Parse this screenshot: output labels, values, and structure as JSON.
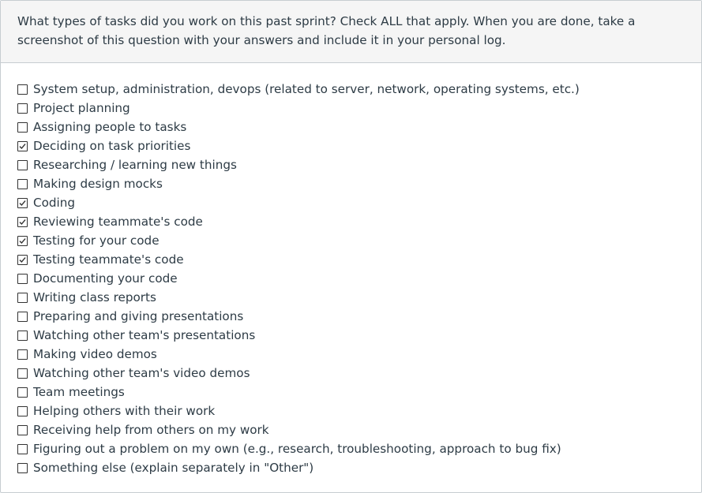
{
  "question": {
    "text": "What types of tasks did you work on this past sprint? Check ALL that apply. When you are done, take a screenshot of this question with your answers and include it in your personal log."
  },
  "options": [
    {
      "label": "System setup, administration, devops (related to server, network, operating systems, etc.)",
      "checked": false
    },
    {
      "label": "Project planning",
      "checked": false
    },
    {
      "label": "Assigning people to tasks",
      "checked": false
    },
    {
      "label": "Deciding on task priorities",
      "checked": true
    },
    {
      "label": "Researching / learning new things",
      "checked": false
    },
    {
      "label": "Making design mocks",
      "checked": false
    },
    {
      "label": "Coding",
      "checked": true
    },
    {
      "label": "Reviewing teammate's code",
      "checked": true
    },
    {
      "label": "Testing for your code",
      "checked": true
    },
    {
      "label": "Testing teammate's code",
      "checked": true
    },
    {
      "label": "Documenting your code",
      "checked": false
    },
    {
      "label": "Writing class reports",
      "checked": false
    },
    {
      "label": "Preparing and giving presentations",
      "checked": false
    },
    {
      "label": "Watching other team's presentations",
      "checked": false
    },
    {
      "label": "Making video demos",
      "checked": false
    },
    {
      "label": "Watching other team's video demos",
      "checked": false
    },
    {
      "label": "Team meetings",
      "checked": false
    },
    {
      "label": "Helping others with their work",
      "checked": false
    },
    {
      "label": "Receiving help from others on my work",
      "checked": false
    },
    {
      "label": "Figuring out a problem on my own (e.g., research, troubleshooting, approach to bug fix)",
      "checked": false
    },
    {
      "label": "Something else (explain separately in \"Other\")",
      "checked": false
    }
  ],
  "colors": {
    "text": "#2d3b45",
    "header_bg": "#f5f5f5",
    "border": "#c7cdd1",
    "checkbox_border": "#333333"
  }
}
